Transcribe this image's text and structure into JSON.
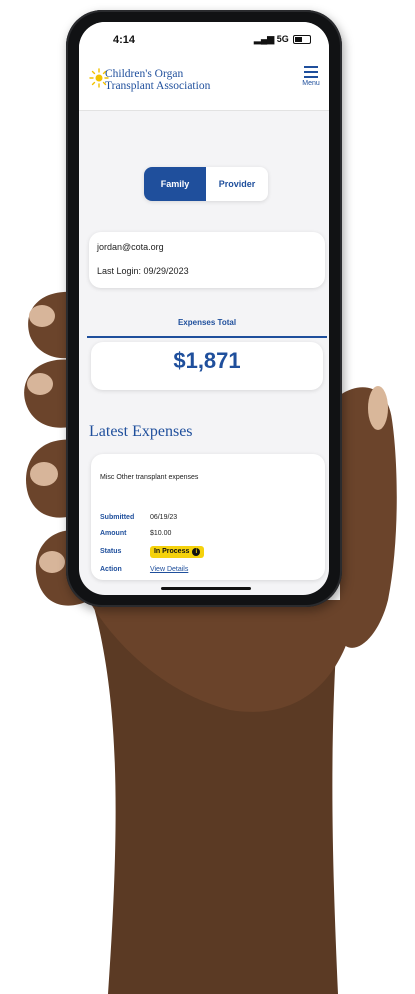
{
  "status_bar": {
    "time": "4:14",
    "network": "5G"
  },
  "header": {
    "org_line1": "Children's Organ",
    "org_line2": "Transplant Association",
    "menu_label": "Menu"
  },
  "account_toggle": {
    "options": [
      "Family",
      "Provider"
    ],
    "selected": "Family"
  },
  "account": {
    "email": "jordan@cota.org",
    "last_login": "Last Login: 09/29/2023"
  },
  "totals": {
    "title": "Expenses Total",
    "amount": "$1,871"
  },
  "latest_expenses": {
    "title": "Latest Expenses",
    "items": [
      {
        "description": "Misc Other transplant expenses",
        "submitted_label": "Submitted",
        "submitted": "06/19/23",
        "amount_label": "Amount",
        "amount": "$10.00",
        "status_label": "Status",
        "status": "In Process",
        "action_label": "Action",
        "action": "View Details"
      }
    ]
  },
  "colors": {
    "brand_blue": "#1f4f9c",
    "status_yellow": "#f5d20c",
    "logo_sun": "#f2c200"
  },
  "icons": {
    "menu": "hamburger-icon",
    "logo": "sun-icon",
    "status_info": "info-icon"
  }
}
